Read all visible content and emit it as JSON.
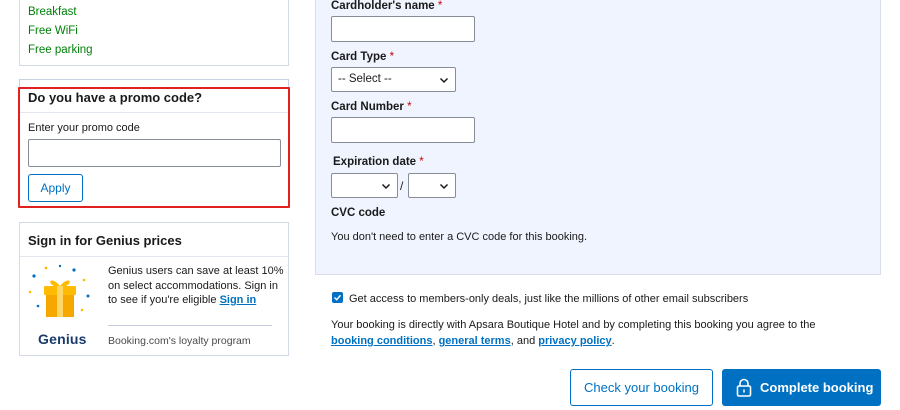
{
  "amenities": [
    "Breakfast",
    "Free WiFi",
    "Free parking"
  ],
  "promo": {
    "title": "Do you have a promo code?",
    "label": "Enter your promo code",
    "input_value": "",
    "apply_label": "Apply"
  },
  "genius": {
    "title": "Sign in for Genius prices",
    "text": "Genius users can save at least 10% on select accommodations. Sign in to see if you're eligible",
    "signin_link": "Sign in",
    "logo": "Genius",
    "program": "Booking.com's loyalty program"
  },
  "payment": {
    "cardholder_label": "Cardholder's name",
    "cardholder_value": "",
    "card_type_label": "Card Type",
    "card_type_value": "-- Select --",
    "card_number_label": "Card Number",
    "card_number_value": "",
    "expiration_label": "Expiration date",
    "exp_month_value": "",
    "exp_year_value": "",
    "exp_separator": "/",
    "required_mark": "*",
    "cvc_label": "CVC code",
    "cvc_note": "You don't need to enter a CVC code for this booking."
  },
  "consent": {
    "deals_checked": true,
    "deals_text": "Get access to members-only deals, just like the millions of other email subscribers",
    "terms_prefix": "Your booking is directly with Apsara Boutique Hotel and by completing this booking you agree to the",
    "booking_conditions": "booking conditions",
    "comma1": ",",
    "general_terms": "general terms",
    "and": ", and",
    "privacy_policy": "privacy policy",
    "period": "."
  },
  "actions": {
    "check_label": "Check your booking",
    "complete_label": "Complete booking"
  },
  "colors": {
    "primary": "#0071c2",
    "success": "#008009",
    "highlight": "#e0211f",
    "panel_bg": "#f0f4ff"
  }
}
